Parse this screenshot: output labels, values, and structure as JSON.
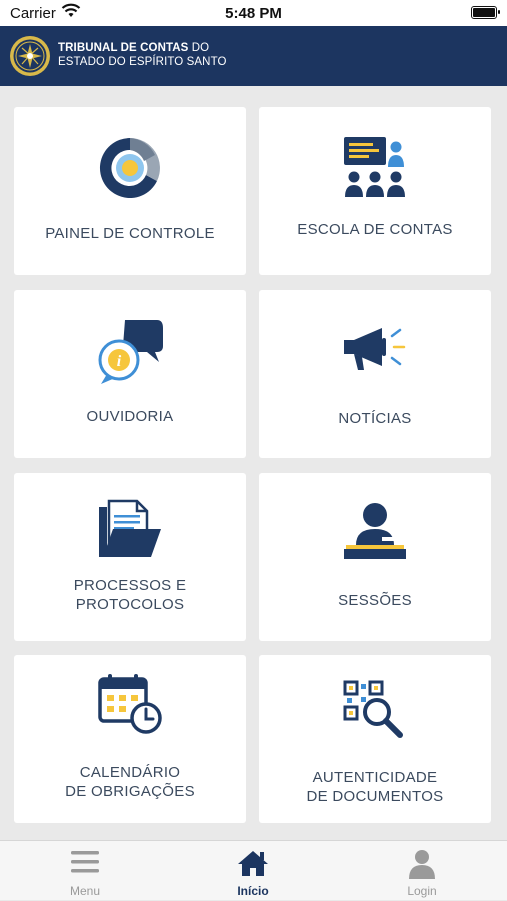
{
  "status_bar": {
    "carrier": "Carrier",
    "time": "5:48 PM"
  },
  "header": {
    "title_bold": "TRIBUNAL DE CONTAS",
    "title_rest": " DO",
    "subtitle": "ESTADO DO ESPÍRITO SANTO"
  },
  "menu": [
    {
      "label": "PAINEL DE CONTROLE",
      "icon": "dashboard-chart-icon"
    },
    {
      "label": "ESCOLA DE CONTAS",
      "icon": "school-classroom-icon"
    },
    {
      "label": "OUVIDORIA",
      "icon": "ombudsman-chat-icon"
    },
    {
      "label": "NOTÍCIAS",
      "icon": "megaphone-icon"
    },
    {
      "label": "PROCESSOS E\nPROTOCOLOS",
      "icon": "folder-documents-icon"
    },
    {
      "label": "SESSÕES",
      "icon": "session-speaker-icon"
    },
    {
      "label": "CALENDÁRIO\nDE OBRIGAÇÕES",
      "icon": "calendar-clock-icon"
    },
    {
      "label": "AUTENTICIDADE\nDE DOCUMENTOS",
      "icon": "qr-search-icon"
    }
  ],
  "tabbar": {
    "items": [
      {
        "label": "Menu",
        "icon": "hamburger-icon",
        "active": false
      },
      {
        "label": "Início",
        "icon": "home-icon",
        "active": true
      },
      {
        "label": "Login",
        "icon": "user-icon",
        "active": false
      }
    ]
  },
  "colors": {
    "header": "#1c3560",
    "icon_navy": "#1f3a64",
    "icon_blue": "#3f8fd6",
    "icon_yellow": "#f6c63c",
    "background": "#e9e9e9"
  }
}
